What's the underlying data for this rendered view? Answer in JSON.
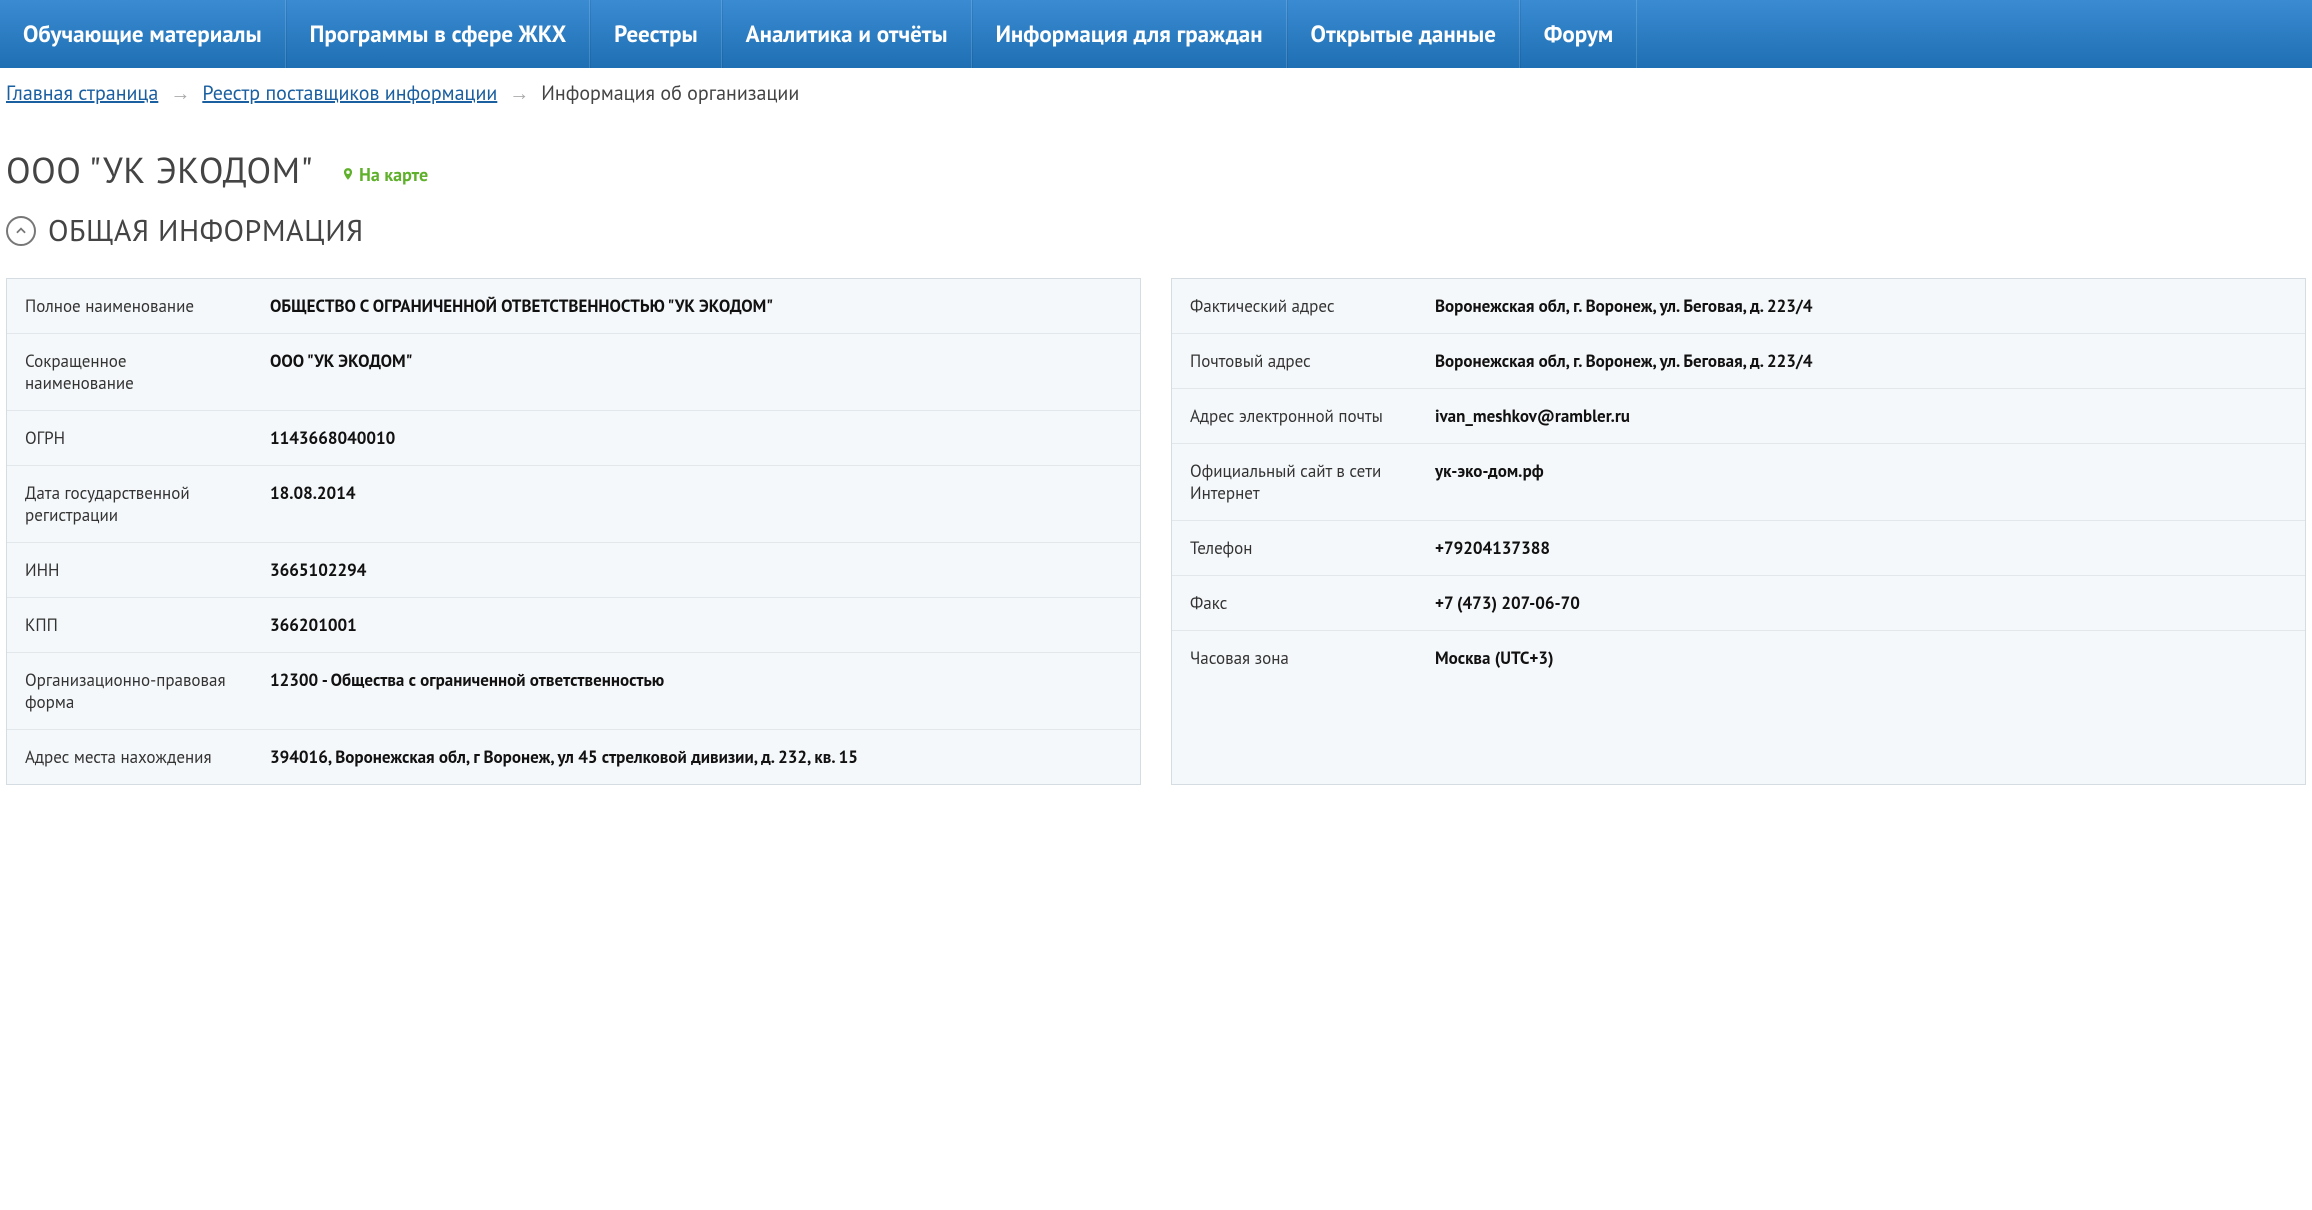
{
  "nav": [
    "Обучающие материалы",
    "Программы в сфере ЖКХ",
    "Реестры",
    "Аналитика и отчёты",
    "Информация для граждан",
    "Открытые данные",
    "Форум"
  ],
  "breadcrumb": {
    "home": "Главная страница",
    "reg": "Реестр поставщиков информации",
    "current": "Информация об организации"
  },
  "title": "ООО \"УК ЭКОДОМ\"",
  "maplink": "На карте",
  "section_title": "ОБЩАЯ ИНФОРМАЦИЯ",
  "left": [
    {
      "label": "Полное наименование",
      "value": "ОБЩЕСТВО С ОГРАНИЧЕННОЙ ОТВЕТСТВЕННОСТЬЮ \"УК ЭКОДОМ\""
    },
    {
      "label": "Сокращенное наименование",
      "value": "ООО \"УК ЭКОДОМ\""
    },
    {
      "label": "ОГРН",
      "value": "1143668040010"
    },
    {
      "label": "Дата государственной регистрации",
      "value": "18.08.2014"
    },
    {
      "label": "ИНН",
      "value": "3665102294"
    },
    {
      "label": "КПП",
      "value": "366201001"
    },
    {
      "label": "Организационно-правовая форма",
      "value": "12300 - Общества с ограниченной ответственностью"
    },
    {
      "label": "Адрес места нахождения",
      "value": "394016, Воронежская обл, г Воронеж, ул 45 стрелковой дивизии, д. 232, кв. 15"
    }
  ],
  "right": [
    {
      "label": "Фактический адрес",
      "value": "Воронежская обл, г. Воронеж, ул. Беговая, д. 223/4"
    },
    {
      "label": "Почтовый адрес",
      "value": "Воронежская обл, г. Воронеж, ул. Беговая, д. 223/4"
    },
    {
      "label": "Адрес электронной почты",
      "value": "ivan_meshkov@rambler.ru"
    },
    {
      "label": "Официальный сайт в сети Интернет",
      "value": "ук-эко-дом.рф"
    },
    {
      "label": "Телефон",
      "value": "+79204137388"
    },
    {
      "label": "Факс",
      "value": "+7 (473) 207-06-70"
    },
    {
      "label": "Часовая зона",
      "value": "Москва (UTC+3)"
    }
  ]
}
